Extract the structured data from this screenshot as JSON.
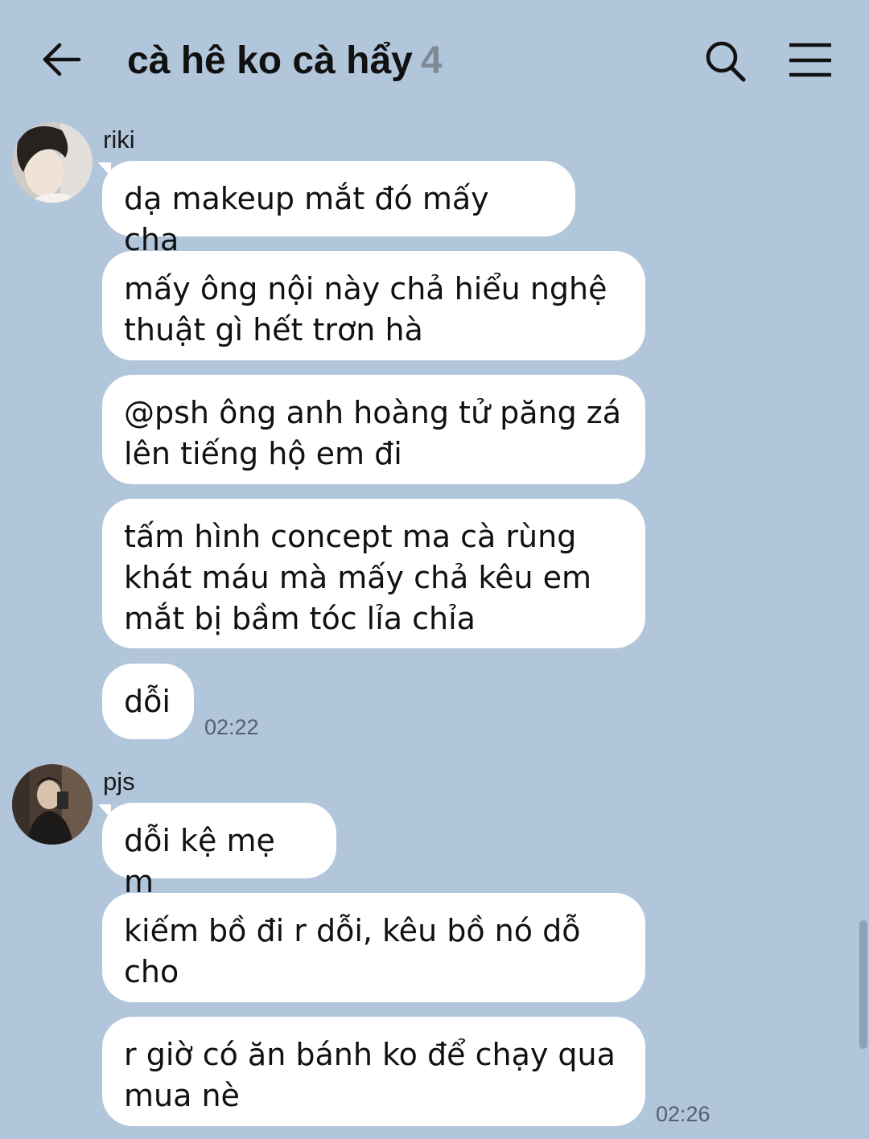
{
  "header": {
    "title": "cà hê ko cà hẩy",
    "member_count": "4"
  },
  "groups": [
    {
      "sender": "riki",
      "avatar": "riki-avatar",
      "messages": [
        "dạ makeup mắt đó mấy cha",
        "mấy ông nội này chả hiểu nghệ\nthuật gì hết trơn hà",
        "@psh ông anh hoàng tử păng zá\nlên tiếng hộ em đi",
        "tấm hình concept ma cà rùng\nkhát máu mà mấy chả kêu em\nmắt bị bầm tóc lỉa chỉa",
        "dỗi"
      ],
      "time": "02:22"
    },
    {
      "sender": "pjs",
      "avatar": "pjs-avatar",
      "messages": [
        "dỗi kệ mẹ m",
        "kiếm bồ đi r dỗi, kêu bồ nó dỗ\ncho",
        "r giờ có ăn bánh ko để chạy qua\nmua nè"
      ],
      "time": "02:26"
    }
  ],
  "icons": [
    "back-arrow-icon",
    "search-icon",
    "menu-icon"
  ],
  "colors": {
    "background": "#b1c6db",
    "bubble": "#ffffff",
    "member_count": "#7f8a96",
    "time": "#56606b"
  }
}
